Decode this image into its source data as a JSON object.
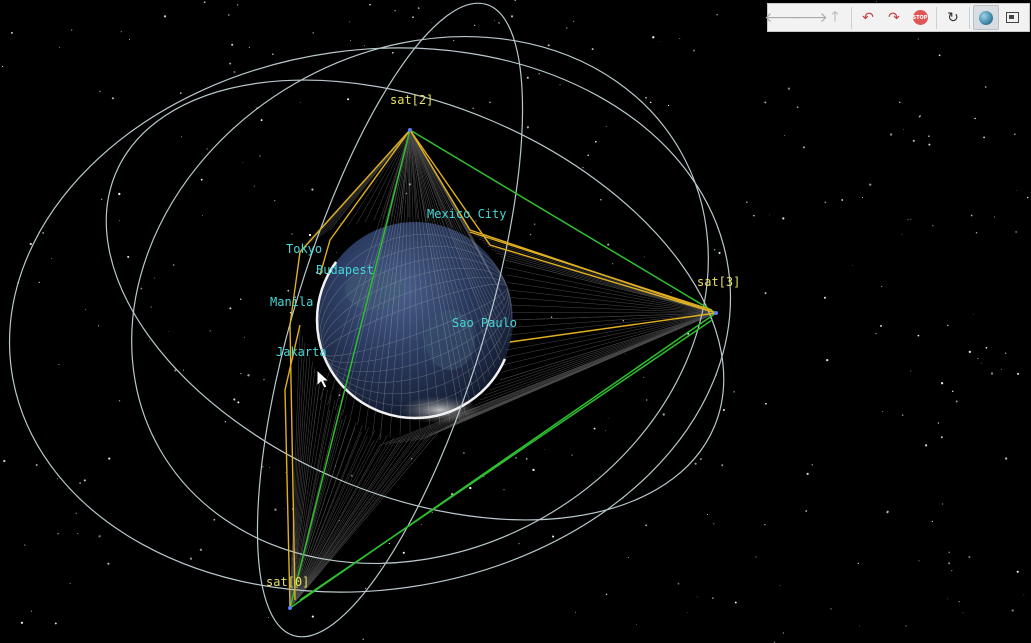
{
  "toolbar": {
    "buttons": [
      {
        "name": "back-button",
        "icon": "arrow-left-icon",
        "glyph": "🡐"
      },
      {
        "name": "forward-button",
        "icon": "arrow-right-icon",
        "glyph": "🡒"
      },
      {
        "name": "up-button",
        "icon": "arrow-up-icon",
        "glyph": "🡑"
      },
      {
        "name": "rotate-back-button",
        "icon": "curved-arrow-back-icon",
        "glyph": "↶"
      },
      {
        "name": "rotate-forward-button",
        "icon": "curved-arrow-forward-icon",
        "glyph": "↷"
      },
      {
        "name": "stop-button",
        "icon": "stop-icon",
        "glyph": "STOP"
      },
      {
        "name": "reset-button",
        "icon": "reload-icon",
        "glyph": "↻"
      },
      {
        "name": "globe-view-button",
        "icon": "globe-icon",
        "glyph": ""
      },
      {
        "name": "panel-button",
        "icon": "panel-icon",
        "glyph": ""
      }
    ]
  },
  "satellites": [
    {
      "id": "sat0",
      "label": "sat[0]"
    },
    {
      "id": "sat2",
      "label": "sat[2]"
    },
    {
      "id": "sat3",
      "label": "sat[3]"
    }
  ],
  "cities": [
    {
      "id": "mexico",
      "label": "Mexico City"
    },
    {
      "id": "tokyo",
      "label": "Tokyo"
    },
    {
      "id": "budapest",
      "label": "Budapest"
    },
    {
      "id": "manila",
      "label": "Manila"
    },
    {
      "id": "sao",
      "label": "Sao Paulo"
    },
    {
      "id": "jakarta",
      "label": "Jakarta"
    }
  ],
  "colors": {
    "background": "#000000",
    "orbit": "#b8c8cc",
    "link_green": "#2ec02e",
    "link_yellow": "#e0b020",
    "sat_label": "#e8e060",
    "city_label": "#45d7d7",
    "earth_outline": "#f2f2f2"
  }
}
